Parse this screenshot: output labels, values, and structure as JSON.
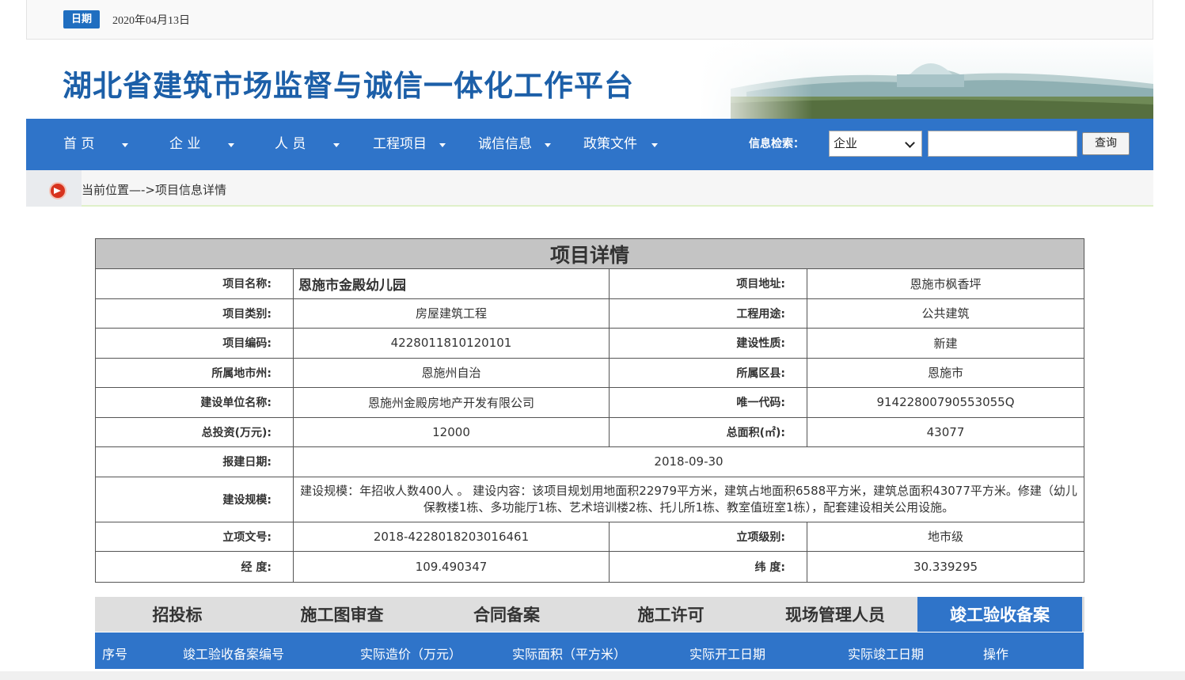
{
  "date": {
    "badge": "日期",
    "value": "2020年04月13日"
  },
  "site_title": "湖北省建筑市场监督与诚信一体化工作平台",
  "nav": {
    "items": [
      {
        "label": "首 页"
      },
      {
        "label": "企 业"
      },
      {
        "label": "人 员"
      },
      {
        "label": "工程项目"
      },
      {
        "label": "诚信信息"
      },
      {
        "label": "政策文件"
      }
    ],
    "search_label": "信息检索：",
    "search_select_value": "企业",
    "search_input_value": "",
    "search_button": "查询"
  },
  "breadcrumb": "当前位置—->项目信息详情",
  "detail": {
    "heading": "项目详情",
    "rows": [
      {
        "l1": "项目名称:",
        "v1": "恩施市金殿幼儿园",
        "l2": "项目地址:",
        "v2": "恩施市枫香坪"
      },
      {
        "l1": "项目类别:",
        "v1": "房屋建筑工程",
        "l2": "工程用途:",
        "v2": "公共建筑"
      },
      {
        "l1": "项目编码:",
        "v1": "4228011810120101",
        "l2": "建设性质:",
        "v2": "新建"
      },
      {
        "l1": "所属地市州:",
        "v1": "恩施州自治",
        "l2": "所属区县:",
        "v2": "恩施市"
      },
      {
        "l1": "建设单位名称:",
        "v1": "恩施州金殿房地产开发有限公司",
        "l2": "唯一代码:",
        "v2": "91422800790553055Q"
      },
      {
        "l1": "总投资(万元):",
        "v1": "12000",
        "l2": "总面积(㎡):",
        "v2": "43077"
      }
    ],
    "report_date_label": "报建日期:",
    "report_date": "2018-09-30",
    "scale_label": "建设规模:",
    "scale_text": "建设规模：年招收人数400人 。 建设内容：该项目规划用地面积22979平方米，建筑占地面积6588平方米，建筑总面积43077平方米。修建（幼儿保教楼1栋、多功能厅1栋、艺术培训楼2栋、托儿所1栋、教室值班室1栋），配套建设相关公用设施。",
    "rows2": [
      {
        "l1": "立项文号:",
        "v1": "2018-4228018203016461",
        "l2": "立项级别:",
        "v2": "地市级"
      },
      {
        "l1": "经 度:",
        "v1": "109.490347",
        "l2": "纬 度:",
        "v2": "30.339295"
      }
    ]
  },
  "tabs": [
    {
      "label": "招投标"
    },
    {
      "label": "施工图审查"
    },
    {
      "label": "合同备案"
    },
    {
      "label": "施工许可"
    },
    {
      "label": "现场管理人员"
    },
    {
      "label": "竣工验收备案"
    }
  ],
  "table_headers": [
    "序号",
    "竣工验收备案编号",
    "实际造价（万元）",
    "实际面积（平方米）",
    "实际开工日期",
    "实际竣工日期",
    "操作"
  ],
  "colors": {
    "nav_blue": "#2f74c9",
    "title_blue": "#1c5fa8",
    "date_badge": "#1f6ec0"
  }
}
